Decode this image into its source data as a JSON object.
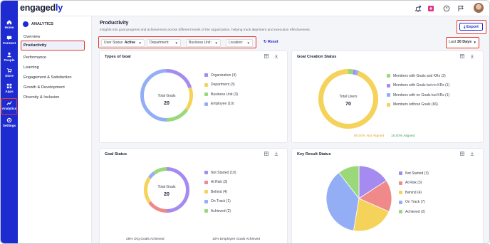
{
  "app": {
    "logo_main": "engaged",
    "logo_accent": "ly"
  },
  "rail": {
    "items": [
      {
        "label": "Home",
        "icon": "home-icon"
      },
      {
        "label": "Connect",
        "icon": "connect-icon"
      },
      {
        "label": "People",
        "icon": "people-icon"
      },
      {
        "label": "Store",
        "icon": "store-icon"
      },
      {
        "label": "Apps",
        "icon": "apps-icon"
      },
      {
        "label": "Analytics",
        "icon": "analytics-icon"
      },
      {
        "label": "Settings",
        "icon": "settings-icon"
      }
    ]
  },
  "submenu": {
    "header": "ANALYTICS",
    "items": [
      "Overview",
      "Productivity",
      "Performance",
      "Learning",
      "Engagement & Satisfaction",
      "Growth & Development",
      "Diversity & Inclusion"
    ],
    "active": "Productivity"
  },
  "page": {
    "title": "Productivity",
    "subtitle": "Insights into goal progress and achievement across different levels of the organization, helping track alignment and execution effectiveness.",
    "export_label": "Export",
    "reset_label": "Reset",
    "date_prefix": "Last",
    "date_value": "30 Days"
  },
  "filters": [
    {
      "label": "User Status:",
      "value": "Active"
    },
    {
      "label": "Department:",
      "value": ""
    },
    {
      "label": "Business Unit:",
      "value": ""
    },
    {
      "label": "Location:",
      "value": ""
    }
  ],
  "colors": {
    "primary": "#1d2bd0",
    "highlight": "#e2392c",
    "purple": "#a58bf0",
    "yellow": "#f5d35a",
    "green": "#9bd87a",
    "blue": "#93aef5",
    "red": "#f08a8a"
  },
  "cards": {
    "types_of_goal": {
      "title": "Types of Goal",
      "center_label": "Total Goals",
      "center_value": "20",
      "legend": [
        "Organization (4)",
        "Department (3)",
        "Business Unit (3)",
        "Employee (10)"
      ]
    },
    "goal_creation": {
      "title": "Goal Creation Status",
      "center_label": "Total Users",
      "center_value": "70",
      "legend": [
        "Members with Goals and KRs (2)",
        "Members with Goals but no KRs (1)",
        "Members with no Goals but KRs (1)",
        "Members without Goals (66)"
      ],
      "foot_not_aligned": "85.00% Not Aligned",
      "foot_aligned": "15.00% Aligned"
    },
    "goal_status": {
      "title": "Goal Status",
      "center_label": "Total Goals",
      "center_value": "20",
      "legend": [
        "Not Started (10)",
        "At Risk (3)",
        "Behind (4)",
        "On Track (1)",
        "Achieved (2)"
      ],
      "foot_left": "25% Org Goals Achieved",
      "foot_right": "10% Employee Goals Achieved"
    },
    "key_result": {
      "title": "Key Result Status",
      "legend": [
        "Not Started (3)",
        "At Risk (3)",
        "Behind (4)",
        "On Track (7)",
        "Achieved (2)"
      ]
    }
  },
  "chart_data": [
    {
      "type": "pie",
      "title": "Types of Goal",
      "categories": [
        "Organization",
        "Department",
        "Business Unit",
        "Employee"
      ],
      "values": [
        4,
        3,
        3,
        10
      ],
      "colors": [
        "#a58bf0",
        "#f5d35a",
        "#9bd87a",
        "#93aef5"
      ]
    },
    {
      "type": "pie",
      "title": "Goal Creation Status",
      "categories": [
        "Members with Goals and KRs",
        "Members with Goals but no KRs",
        "Members with no Goals but KRs",
        "Members without Goals"
      ],
      "values": [
        2,
        1,
        1,
        66
      ],
      "colors": [
        "#9bd87a",
        "#a58bf0",
        "#93aef5",
        "#f5d35a"
      ]
    },
    {
      "type": "pie",
      "title": "Goal Status",
      "categories": [
        "Not Started",
        "At Risk",
        "Behind",
        "On Track",
        "Achieved"
      ],
      "values": [
        10,
        3,
        4,
        1,
        2
      ],
      "colors": [
        "#a58bf0",
        "#f08a8a",
        "#f5d35a",
        "#93aef5",
        "#9bd87a"
      ]
    },
    {
      "type": "pie",
      "title": "Key Result Status",
      "categories": [
        "Not Started",
        "At Risk",
        "Behind",
        "On Track",
        "Achieved"
      ],
      "values": [
        3,
        3,
        4,
        7,
        2
      ],
      "colors": [
        "#a58bf0",
        "#f08a8a",
        "#f5d35a",
        "#93aef5",
        "#9bd87a"
      ]
    }
  ]
}
